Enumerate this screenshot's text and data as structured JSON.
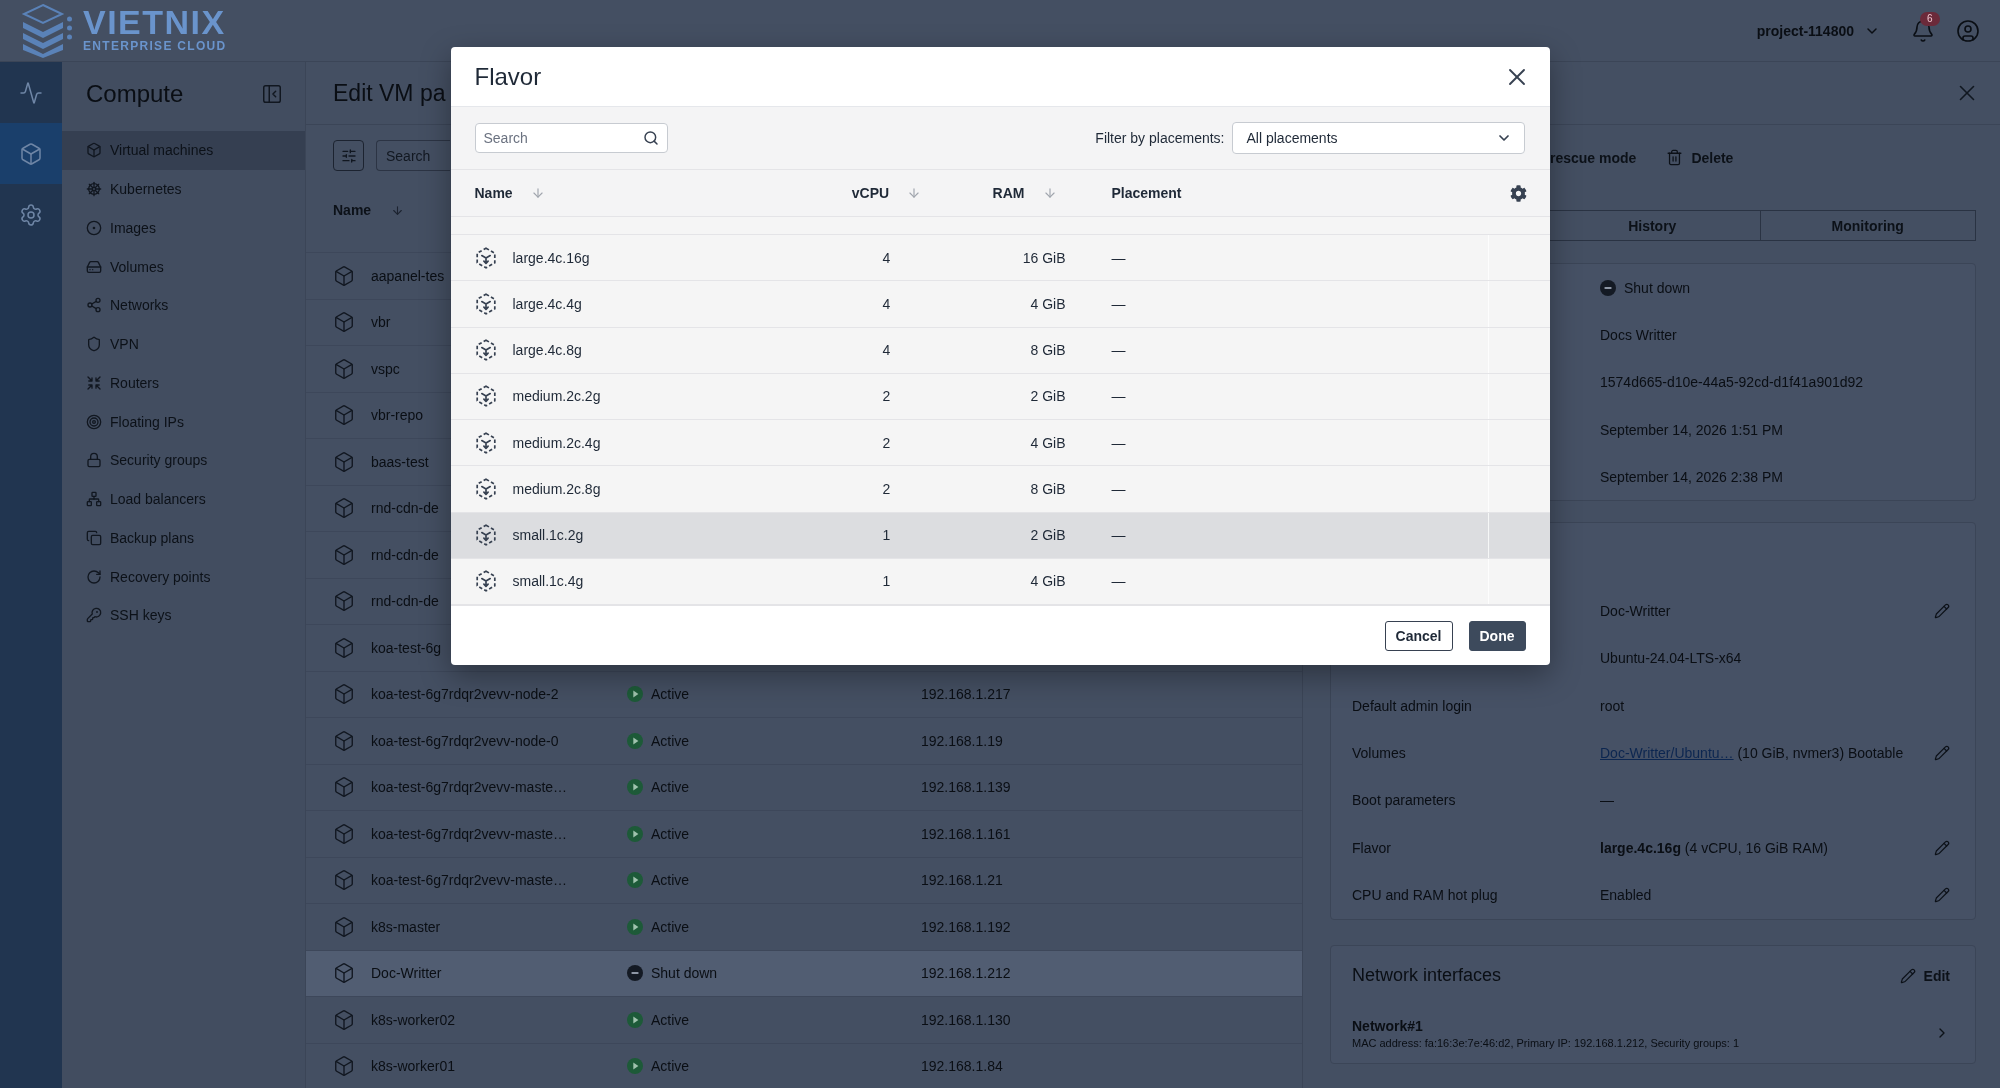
{
  "top_bar": {
    "logo": {
      "name": "VIETNIX",
      "tagline": "ENTERPRISE CLOUD"
    },
    "project": "project-114800",
    "notification_count": "6"
  },
  "icon_rail": {
    "items": [
      {
        "selected": false
      },
      {
        "selected": true
      },
      {
        "selected": false
      }
    ]
  },
  "sidebar": {
    "title": "Compute",
    "items": [
      {
        "label": "Virtual machines",
        "selected": true
      },
      {
        "label": "Kubernetes",
        "selected": false
      },
      {
        "label": "Images",
        "selected": false
      },
      {
        "label": "Volumes",
        "selected": false
      },
      {
        "label": "Networks",
        "selected": false
      },
      {
        "label": "VPN",
        "selected": false
      },
      {
        "label": "Routers",
        "selected": false
      },
      {
        "label": "Floating IPs",
        "selected": false
      },
      {
        "label": "Security groups",
        "selected": false
      },
      {
        "label": "Load balancers",
        "selected": false
      },
      {
        "label": "Backup plans",
        "selected": false
      },
      {
        "label": "Recovery points",
        "selected": false
      },
      {
        "label": "SSH keys",
        "selected": false
      }
    ]
  },
  "drawer": {
    "title": "Edit VM pa"
  },
  "vm_list": {
    "search": {
      "placeholder": "Search"
    },
    "columns": [
      {
        "label": "Name",
        "sortable": true
      }
    ],
    "rows": [
      {
        "name": "aapanel-tes",
        "selected": false
      },
      {
        "name": "vbr",
        "selected": false
      },
      {
        "name": "vspc",
        "selected": false
      },
      {
        "name": "vbr-repo",
        "selected": false
      },
      {
        "name": "baas-test",
        "selected": false
      },
      {
        "name": "rnd-cdn-de",
        "selected": false
      },
      {
        "name": "rnd-cdn-de",
        "selected": false
      },
      {
        "name": "rnd-cdn-de",
        "selected": false
      },
      {
        "name": "koa-test-6g",
        "selected": false
      },
      {
        "name": "koa-test-6g7rdqr2vevv-node-2",
        "status": {
          "label": "Active",
          "kind": "active"
        },
        "ip": "192.168.1.217",
        "selected": false
      },
      {
        "name": "koa-test-6g7rdqr2vevv-node-0",
        "status": {
          "label": "Active",
          "kind": "active"
        },
        "ip": "192.168.1.19",
        "selected": false
      },
      {
        "name": "koa-test-6g7rdqr2vevv-maste…",
        "status": {
          "label": "Active",
          "kind": "active"
        },
        "ip": "192.168.1.139",
        "selected": false
      },
      {
        "name": "koa-test-6g7rdqr2vevv-maste…",
        "status": {
          "label": "Active",
          "kind": "active"
        },
        "ip": "192.168.1.161",
        "selected": false
      },
      {
        "name": "koa-test-6g7rdqr2vevv-maste…",
        "status": {
          "label": "Active",
          "kind": "active"
        },
        "ip": "192.168.1.21",
        "selected": false
      },
      {
        "name": "k8s-master",
        "status": {
          "label": "Active",
          "kind": "active"
        },
        "ip": "192.168.1.192",
        "selected": false
      },
      {
        "name": "Doc-Writter",
        "status": {
          "label": "Shut down",
          "kind": "shut_down"
        },
        "ip": "192.168.1.212",
        "selected": true
      },
      {
        "name": "k8s-worker02",
        "status": {
          "label": "Active",
          "kind": "active"
        },
        "ip": "192.168.1.130",
        "selected": false
      },
      {
        "name": "k8s-worker01",
        "status": {
          "label": "Active",
          "kind": "active"
        },
        "ip": "192.168.1.84",
        "selected": false
      }
    ]
  },
  "details": {
    "actions": {
      "rescue_mode": "rescue mode",
      "delete": "Delete"
    },
    "tabs": [
      {
        "label": "History",
        "selected": false
      },
      {
        "label": "Monitoring",
        "selected": false
      }
    ],
    "summary": [
      {
        "value": "Shut down",
        "kind": "shut_down"
      },
      {
        "value": "Docs Writter",
        "kind": "text"
      },
      {
        "value": "1574d665-d10e-44a5-92cd-d1f41a901d92",
        "kind": "text"
      },
      {
        "value": "September 14, 2026 1:51 PM",
        "kind": "text"
      },
      {
        "value": "September 14, 2026 2:38 PM",
        "kind": "text"
      }
    ],
    "configuration": [
      {
        "value": "Doc-Writter",
        "editable": true
      },
      {
        "value": "Ubuntu-24.04-LTS-x64",
        "editable": false
      },
      {
        "label": "Default admin login",
        "value": "root",
        "editable": false
      },
      {
        "label": "Volumes",
        "link": "Doc-Writter/Ubuntu…",
        "value": "(10 GiB, nvmer3) Bootable",
        "editable": true
      },
      {
        "label": "Boot parameters",
        "value": "—",
        "editable": false
      },
      {
        "label": "Flavor",
        "value": "**large.4c.16g** (4 vCPU, 16 GiB RAM)",
        "editable": true
      },
      {
        "label": "CPU and RAM hot plug",
        "value": "Enabled",
        "editable": true
      }
    ],
    "network_interfaces": {
      "title": "Network interfaces",
      "edit": "Edit",
      "items": [
        {
          "name": "Network#1",
          "details": "MAC address: fa:16:3e:7e:46:d2, Primary IP: 192.168.1.212, Security groups: 1"
        }
      ]
    }
  },
  "modal": {
    "title": "Flavor",
    "search": {
      "placeholder": "Search"
    },
    "filter": {
      "label": "Filter by placements:",
      "value": "All placements"
    },
    "columns": [
      {
        "label": "Name",
        "sortable": true
      },
      {
        "label": "vCPU",
        "sortable": true
      },
      {
        "label": "RAM",
        "sortable": true
      },
      {
        "label": "Placement",
        "sortable": false
      }
    ],
    "rows": [
      {
        "name": "large.4c.16g",
        "vcpu": "4",
        "ram": "16 GiB",
        "placement": "—",
        "selected": false
      },
      {
        "name": "large.4c.4g",
        "vcpu": "4",
        "ram": "4 GiB",
        "placement": "—",
        "selected": false
      },
      {
        "name": "large.4c.8g",
        "vcpu": "4",
        "ram": "8 GiB",
        "placement": "—",
        "selected": false
      },
      {
        "name": "medium.2c.2g",
        "vcpu": "2",
        "ram": "2 GiB",
        "placement": "—",
        "selected": false
      },
      {
        "name": "medium.2c.4g",
        "vcpu": "2",
        "ram": "4 GiB",
        "placement": "—",
        "selected": false
      },
      {
        "name": "medium.2c.8g",
        "vcpu": "2",
        "ram": "8 GiB",
        "placement": "—",
        "selected": false
      },
      {
        "name": "small.1c.2g",
        "vcpu": "1",
        "ram": "2 GiB",
        "placement": "—",
        "selected": true
      },
      {
        "name": "small.1c.4g",
        "vcpu": "1",
        "ram": "4 GiB",
        "placement": "—",
        "selected": false
      }
    ],
    "buttons": [
      {
        "label": "Cancel",
        "kind": "secondary"
      },
      {
        "label": "Done",
        "kind": "primary"
      }
    ]
  }
}
